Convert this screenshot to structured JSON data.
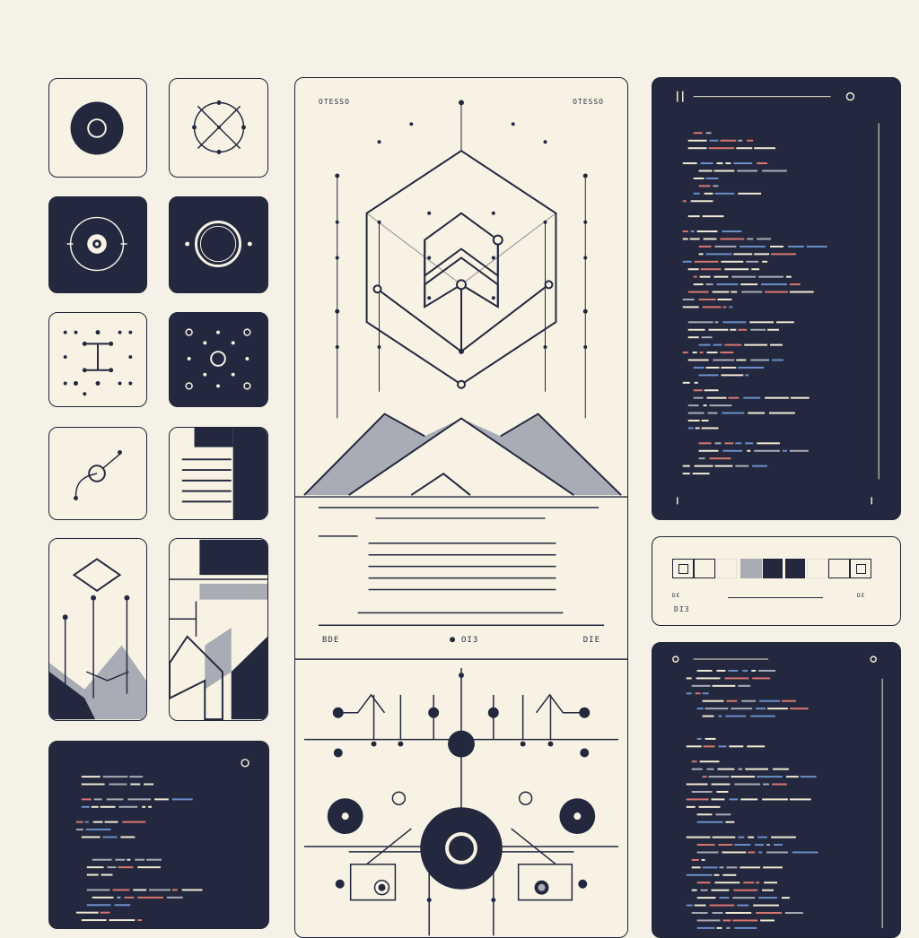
{
  "colors": {
    "background": "#f5f1e6",
    "card_light": "#f7f2e3",
    "navy": "#23283f",
    "grey": "#a9acb5",
    "code_red": "#d9776f",
    "code_blue": "#6b8fc9",
    "code_cream": "#f1ead3"
  },
  "center_panel": {
    "top_left_tag": "OTESSO",
    "top_right_tag": "OTESSO",
    "footer_left": "BDE",
    "footer_center": "OI3",
    "footer_right": "DIE"
  },
  "palette_card": {
    "label_left": "DI3",
    "tick_left": "DE",
    "tick_right": "DE"
  },
  "icons": [
    "target-icon",
    "crosshair-icon",
    "focus-ring-icon",
    "circle-icon",
    "node-grid-icon",
    "dot-cluster-icon",
    "curve-node-icon",
    "document-lines-icon",
    "mountain-diamond-icon",
    "geometric-pattern-icon"
  ]
}
